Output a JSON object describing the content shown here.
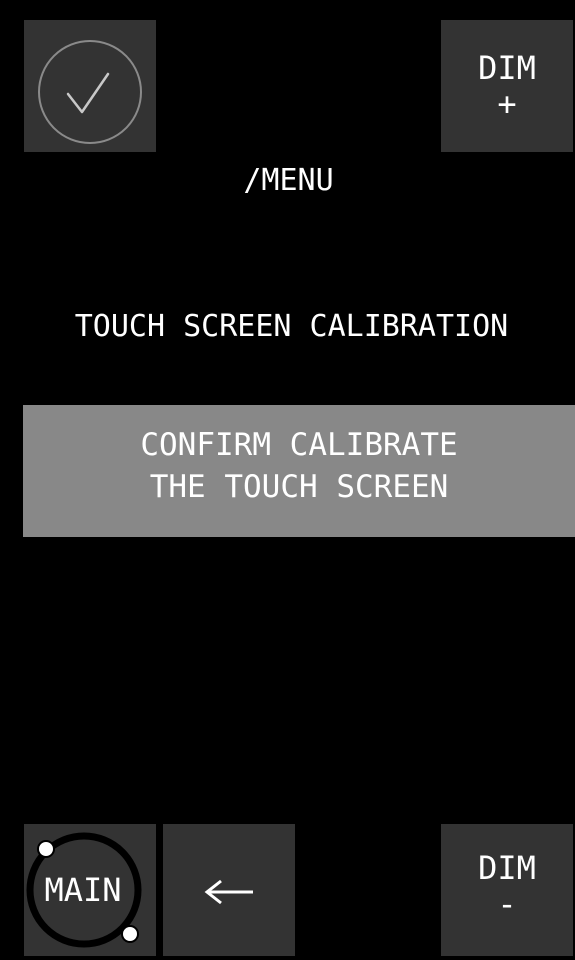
{
  "header": {
    "dim_plus": {
      "line1": "DIM",
      "line2": "+"
    },
    "path": "/MENU"
  },
  "main": {
    "section_title": "TOUCH SCREEN CALIBRATION",
    "confirm": {
      "line1": "CONFIRM CALIBRATE",
      "line2": "THE TOUCH SCREEN"
    }
  },
  "footer": {
    "main_label": "MAIN",
    "back_icon": "left-arrow-icon",
    "dim_minus": {
      "line1": "DIM",
      "line2": "-"
    }
  },
  "icons": {
    "check": "checkmark-circle-icon"
  },
  "colors": {
    "background": "#000000",
    "tile": "#333333",
    "confirm_button": "#888888",
    "text": "#ffffff"
  }
}
